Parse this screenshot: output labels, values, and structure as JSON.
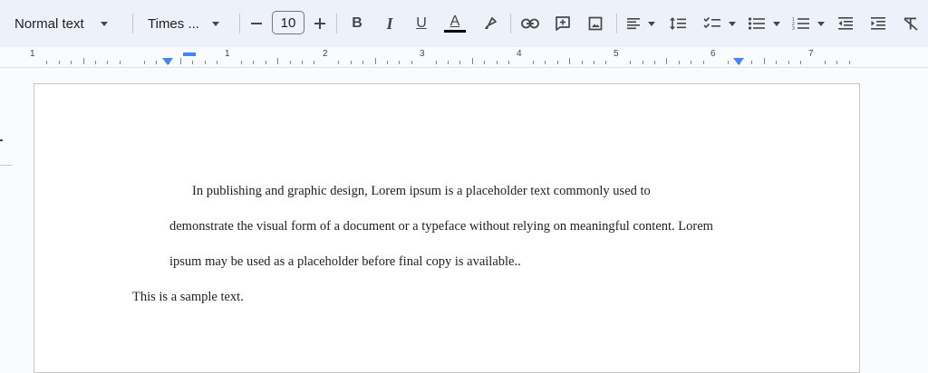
{
  "toolbar": {
    "style_label": "Normal text",
    "font_label": "Times ...",
    "font_size": "10",
    "bold_label": "B",
    "italic_label": "I",
    "underline_label": "U",
    "text_color_label": "A",
    "text_color_swatch": "#000000"
  },
  "ruler": {
    "numbers": [
      "1",
      "1",
      "2",
      "3",
      "4",
      "5",
      "6",
      "7"
    ]
  },
  "document": {
    "line1": "In publishing and graphic design, Lorem ipsum is a placeholder    text commonly used to",
    "line2": "demonstrate the visual form of a document or a typeface without relying on meaningful content. Lorem",
    "line3": "ipsum may be used as a placeholder before final copy is available..",
    "line4": "This is a sample text."
  },
  "colors": {
    "toolbar_bg": "#edf2fa",
    "accent_blue": "#4285f4",
    "page_bg": "#ffffff",
    "canvas_bg": "#f9fbfd"
  }
}
